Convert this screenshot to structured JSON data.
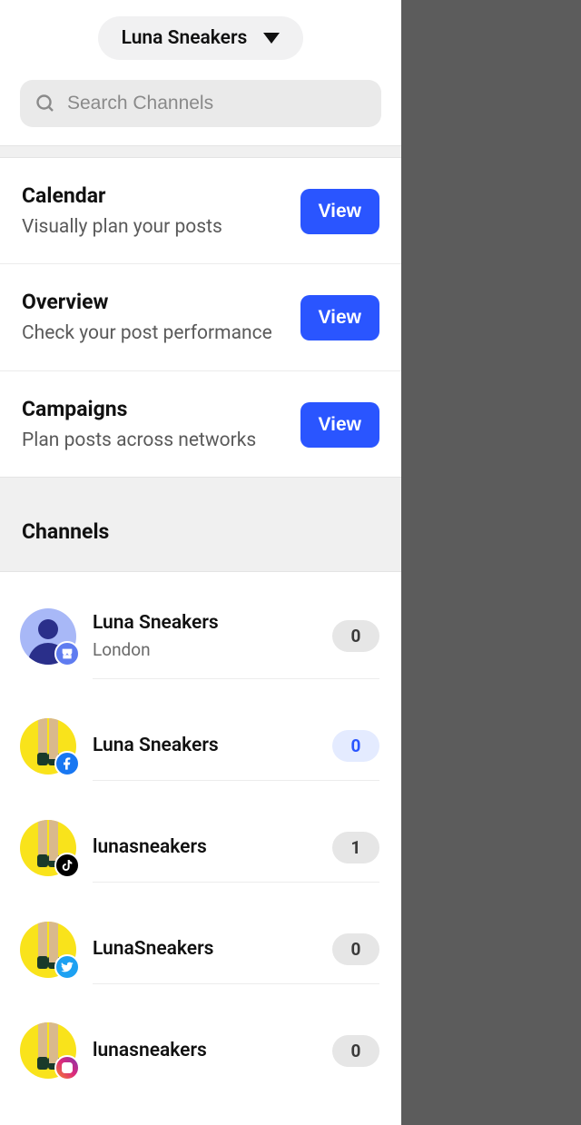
{
  "workspace": {
    "name": "Luna Sneakers"
  },
  "search": {
    "placeholder": "Search Channels"
  },
  "nav": [
    {
      "title": "Calendar",
      "subtitle": "Visually plan your posts",
      "action": "View"
    },
    {
      "title": "Overview",
      "subtitle": "Check your post performance",
      "action": "View"
    },
    {
      "title": "Campaigns",
      "subtitle": "Plan posts across networks",
      "action": "View"
    }
  ],
  "channels_header": "Channels",
  "channels": [
    {
      "name": "Luna Sneakers",
      "subtitle": "London",
      "count": "0",
      "network": "google-business",
      "badge_style": "grey",
      "avatar": "person"
    },
    {
      "name": "Luna Sneakers",
      "subtitle": "",
      "count": "0",
      "network": "facebook",
      "badge_style": "blue",
      "avatar": "legs"
    },
    {
      "name": "lunasneakers",
      "subtitle": "",
      "count": "1",
      "network": "tiktok",
      "badge_style": "grey",
      "avatar": "legs"
    },
    {
      "name": "LunaSneakers",
      "subtitle": "",
      "count": "0",
      "network": "twitter",
      "badge_style": "grey",
      "avatar": "legs"
    },
    {
      "name": "lunasneakers",
      "subtitle": "",
      "count": "0",
      "network": "instagram",
      "badge_style": "grey",
      "avatar": "legs"
    }
  ]
}
